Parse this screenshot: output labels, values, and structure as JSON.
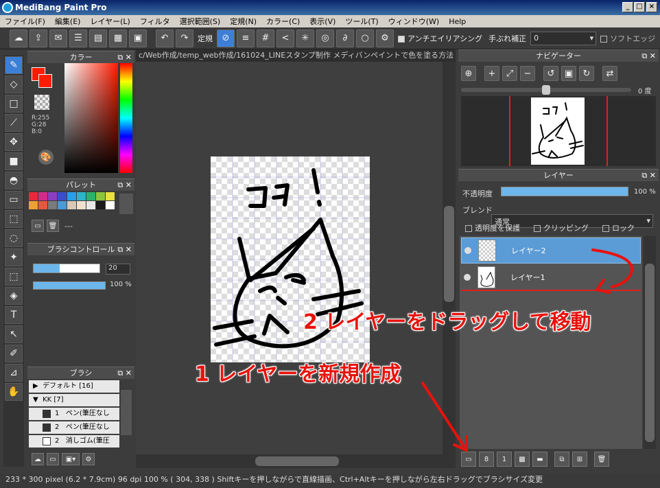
{
  "window": {
    "title": "MediBang Paint Pro",
    "min": "_",
    "max": "□",
    "close": "×"
  },
  "menu": [
    "ファイル(F)",
    "編集(E)",
    "レイヤー(L)",
    "フィルタ",
    "選択範囲(S)",
    "定規(N)",
    "カラー(C)",
    "表示(V)",
    "ツール(T)",
    "ウィンドウ(W)",
    "Help"
  ],
  "toolbar": {
    "ruler_label": "定規",
    "antialias_label": "アンチエイリアシング",
    "stabilizer_label": "手ぶれ補正",
    "stabilizer_value": "0",
    "soft_edge_label": "ソフトエッジ"
  },
  "path": "c/Web作成/temp_web作成/161024_LINEスタンプ制作 メディバンペイントで色を塗る方法",
  "color_panel": {
    "title": "カラー",
    "r": "R:255",
    "g": "G:28",
    "b": "B:0",
    "fg": "#ff1c00"
  },
  "palette_panel": {
    "title": "パレット",
    "value": "---",
    "colors": [
      "#e8283c",
      "#d62a8a",
      "#8a3ec2",
      "#3a4ec8",
      "#2a9ee8",
      "#28b6c8",
      "#2ab26a",
      "#8cc43c",
      "#e8e040",
      "#f0a030",
      "#e8583c",
      "#7a7a7a",
      "#4a9ad8",
      "#d8c8b8",
      "#f0e0d0",
      "#e8e8e8",
      "#1a1a1a",
      "#ffffff"
    ]
  },
  "brush_control": {
    "title": "ブラシコントロール",
    "size": "20",
    "opacity": "100 %"
  },
  "brush_panel": {
    "title": "ブラシ",
    "groups": [
      {
        "label": "デフォルト [16]"
      },
      {
        "label": "KK [7]"
      }
    ],
    "items": [
      {
        "num": "1",
        "label": "ペン(筆圧なし"
      },
      {
        "num": "2",
        "label": "ペン(筆圧なし"
      },
      {
        "num": "2",
        "label": "消しゴム(筆圧"
      }
    ]
  },
  "navigator": {
    "title": "ナビゲーター",
    "angle": "0 度"
  },
  "layer_panel": {
    "title": "レイヤー",
    "opacity_label": "不透明度",
    "opacity_value": "100 %",
    "blend_label": "ブレンド",
    "blend_value": "通常",
    "protect_label": "透明度を保護",
    "clipping_label": "クリッピング",
    "lock_label": "ロック",
    "layers": [
      "レイヤー2",
      "レイヤー1"
    ]
  },
  "annotations": {
    "step1": "1 レイヤーを新規作成",
    "step2": "2 レイヤーをドラッグして移動"
  },
  "status": "233 * 300 pixel   (6.2 * 7.9cm)   96 dpi   100 %   ( 304, 338 )   Shiftキーを押しながらで直線描画、Ctrl+Altキーを押しながら左右ドラッグでブラシサイズ変更"
}
